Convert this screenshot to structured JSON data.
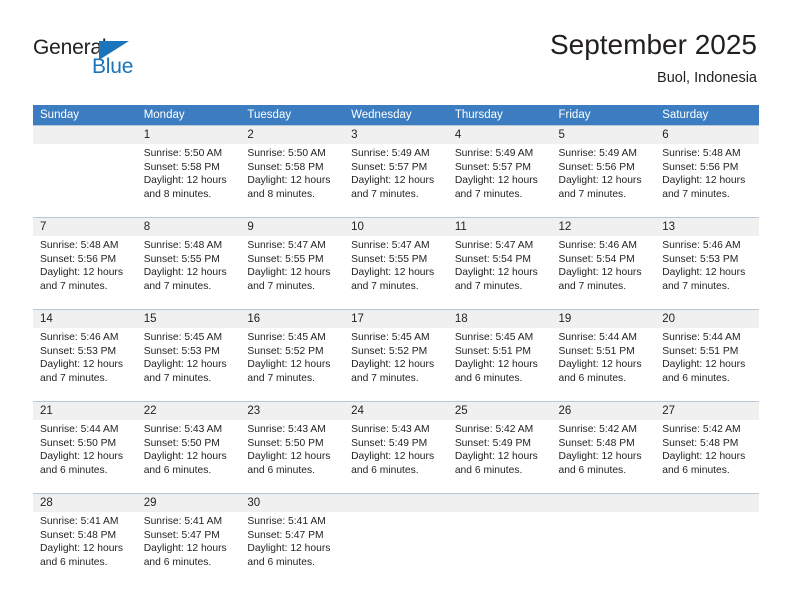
{
  "logo": {
    "primary_text": "General",
    "secondary_text": "Blue",
    "primary_color": "#231f20",
    "secondary_color": "#1c75bc"
  },
  "header": {
    "title": "September 2025",
    "location": "Buol, Indonesia"
  },
  "theme": {
    "header_row_color": "#3b7dc0",
    "daynum_row_color": "#f0f0f0",
    "text_color": "#231f20"
  },
  "calendar": {
    "weekday_headers": [
      "Sunday",
      "Monday",
      "Tuesday",
      "Wednesday",
      "Thursday",
      "Friday",
      "Saturday"
    ],
    "weeks": [
      [
        {
          "day": "",
          "sunrise": "",
          "sunset": "",
          "daylight_line1": "",
          "daylight_line2": ""
        },
        {
          "day": "1",
          "sunrise": "Sunrise: 5:50 AM",
          "sunset": "Sunset: 5:58 PM",
          "daylight_line1": "Daylight: 12 hours",
          "daylight_line2": "and 8 minutes."
        },
        {
          "day": "2",
          "sunrise": "Sunrise: 5:50 AM",
          "sunset": "Sunset: 5:58 PM",
          "daylight_line1": "Daylight: 12 hours",
          "daylight_line2": "and 8 minutes."
        },
        {
          "day": "3",
          "sunrise": "Sunrise: 5:49 AM",
          "sunset": "Sunset: 5:57 PM",
          "daylight_line1": "Daylight: 12 hours",
          "daylight_line2": "and 7 minutes."
        },
        {
          "day": "4",
          "sunrise": "Sunrise: 5:49 AM",
          "sunset": "Sunset: 5:57 PM",
          "daylight_line1": "Daylight: 12 hours",
          "daylight_line2": "and 7 minutes."
        },
        {
          "day": "5",
          "sunrise": "Sunrise: 5:49 AM",
          "sunset": "Sunset: 5:56 PM",
          "daylight_line1": "Daylight: 12 hours",
          "daylight_line2": "and 7 minutes."
        },
        {
          "day": "6",
          "sunrise": "Sunrise: 5:48 AM",
          "sunset": "Sunset: 5:56 PM",
          "daylight_line1": "Daylight: 12 hours",
          "daylight_line2": "and 7 minutes."
        }
      ],
      [
        {
          "day": "7",
          "sunrise": "Sunrise: 5:48 AM",
          "sunset": "Sunset: 5:56 PM",
          "daylight_line1": "Daylight: 12 hours",
          "daylight_line2": "and 7 minutes."
        },
        {
          "day": "8",
          "sunrise": "Sunrise: 5:48 AM",
          "sunset": "Sunset: 5:55 PM",
          "daylight_line1": "Daylight: 12 hours",
          "daylight_line2": "and 7 minutes."
        },
        {
          "day": "9",
          "sunrise": "Sunrise: 5:47 AM",
          "sunset": "Sunset: 5:55 PM",
          "daylight_line1": "Daylight: 12 hours",
          "daylight_line2": "and 7 minutes."
        },
        {
          "day": "10",
          "sunrise": "Sunrise: 5:47 AM",
          "sunset": "Sunset: 5:55 PM",
          "daylight_line1": "Daylight: 12 hours",
          "daylight_line2": "and 7 minutes."
        },
        {
          "day": "11",
          "sunrise": "Sunrise: 5:47 AM",
          "sunset": "Sunset: 5:54 PM",
          "daylight_line1": "Daylight: 12 hours",
          "daylight_line2": "and 7 minutes."
        },
        {
          "day": "12",
          "sunrise": "Sunrise: 5:46 AM",
          "sunset": "Sunset: 5:54 PM",
          "daylight_line1": "Daylight: 12 hours",
          "daylight_line2": "and 7 minutes."
        },
        {
          "day": "13",
          "sunrise": "Sunrise: 5:46 AM",
          "sunset": "Sunset: 5:53 PM",
          "daylight_line1": "Daylight: 12 hours",
          "daylight_line2": "and 7 minutes."
        }
      ],
      [
        {
          "day": "14",
          "sunrise": "Sunrise: 5:46 AM",
          "sunset": "Sunset: 5:53 PM",
          "daylight_line1": "Daylight: 12 hours",
          "daylight_line2": "and 7 minutes."
        },
        {
          "day": "15",
          "sunrise": "Sunrise: 5:45 AM",
          "sunset": "Sunset: 5:53 PM",
          "daylight_line1": "Daylight: 12 hours",
          "daylight_line2": "and 7 minutes."
        },
        {
          "day": "16",
          "sunrise": "Sunrise: 5:45 AM",
          "sunset": "Sunset: 5:52 PM",
          "daylight_line1": "Daylight: 12 hours",
          "daylight_line2": "and 7 minutes."
        },
        {
          "day": "17",
          "sunrise": "Sunrise: 5:45 AM",
          "sunset": "Sunset: 5:52 PM",
          "daylight_line1": "Daylight: 12 hours",
          "daylight_line2": "and 7 minutes."
        },
        {
          "day": "18",
          "sunrise": "Sunrise: 5:45 AM",
          "sunset": "Sunset: 5:51 PM",
          "daylight_line1": "Daylight: 12 hours",
          "daylight_line2": "and 6 minutes."
        },
        {
          "day": "19",
          "sunrise": "Sunrise: 5:44 AM",
          "sunset": "Sunset: 5:51 PM",
          "daylight_line1": "Daylight: 12 hours",
          "daylight_line2": "and 6 minutes."
        },
        {
          "day": "20",
          "sunrise": "Sunrise: 5:44 AM",
          "sunset": "Sunset: 5:51 PM",
          "daylight_line1": "Daylight: 12 hours",
          "daylight_line2": "and 6 minutes."
        }
      ],
      [
        {
          "day": "21",
          "sunrise": "Sunrise: 5:44 AM",
          "sunset": "Sunset: 5:50 PM",
          "daylight_line1": "Daylight: 12 hours",
          "daylight_line2": "and 6 minutes."
        },
        {
          "day": "22",
          "sunrise": "Sunrise: 5:43 AM",
          "sunset": "Sunset: 5:50 PM",
          "daylight_line1": "Daylight: 12 hours",
          "daylight_line2": "and 6 minutes."
        },
        {
          "day": "23",
          "sunrise": "Sunrise: 5:43 AM",
          "sunset": "Sunset: 5:50 PM",
          "daylight_line1": "Daylight: 12 hours",
          "daylight_line2": "and 6 minutes."
        },
        {
          "day": "24",
          "sunrise": "Sunrise: 5:43 AM",
          "sunset": "Sunset: 5:49 PM",
          "daylight_line1": "Daylight: 12 hours",
          "daylight_line2": "and 6 minutes."
        },
        {
          "day": "25",
          "sunrise": "Sunrise: 5:42 AM",
          "sunset": "Sunset: 5:49 PM",
          "daylight_line1": "Daylight: 12 hours",
          "daylight_line2": "and 6 minutes."
        },
        {
          "day": "26",
          "sunrise": "Sunrise: 5:42 AM",
          "sunset": "Sunset: 5:48 PM",
          "daylight_line1": "Daylight: 12 hours",
          "daylight_line2": "and 6 minutes."
        },
        {
          "day": "27",
          "sunrise": "Sunrise: 5:42 AM",
          "sunset": "Sunset: 5:48 PM",
          "daylight_line1": "Daylight: 12 hours",
          "daylight_line2": "and 6 minutes."
        }
      ],
      [
        {
          "day": "28",
          "sunrise": "Sunrise: 5:41 AM",
          "sunset": "Sunset: 5:48 PM",
          "daylight_line1": "Daylight: 12 hours",
          "daylight_line2": "and 6 minutes."
        },
        {
          "day": "29",
          "sunrise": "Sunrise: 5:41 AM",
          "sunset": "Sunset: 5:47 PM",
          "daylight_line1": "Daylight: 12 hours",
          "daylight_line2": "and 6 minutes."
        },
        {
          "day": "30",
          "sunrise": "Sunrise: 5:41 AM",
          "sunset": "Sunset: 5:47 PM",
          "daylight_line1": "Daylight: 12 hours",
          "daylight_line2": "and 6 minutes."
        },
        {
          "day": "",
          "sunrise": "",
          "sunset": "",
          "daylight_line1": "",
          "daylight_line2": ""
        },
        {
          "day": "",
          "sunrise": "",
          "sunset": "",
          "daylight_line1": "",
          "daylight_line2": ""
        },
        {
          "day": "",
          "sunrise": "",
          "sunset": "",
          "daylight_line1": "",
          "daylight_line2": ""
        },
        {
          "day": "",
          "sunrise": "",
          "sunset": "",
          "daylight_line1": "",
          "daylight_line2": ""
        }
      ]
    ]
  }
}
